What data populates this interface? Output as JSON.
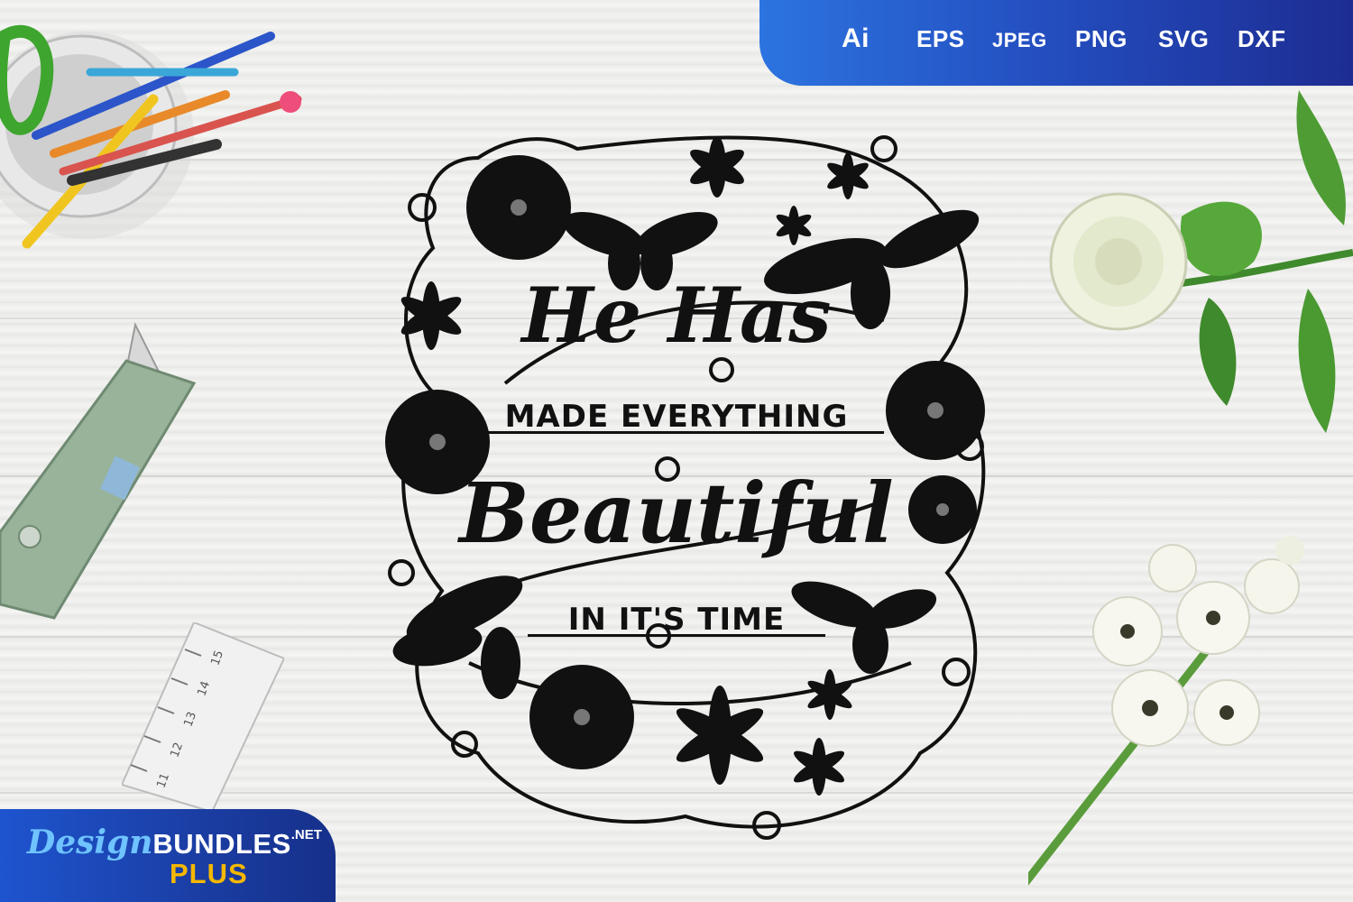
{
  "formats": {
    "items": [
      "Ai",
      "EPS",
      "JPEG",
      "PNG",
      "SVG",
      "DXF"
    ],
    "background_start": "#2c74e0",
    "background_end": "#1d2c92"
  },
  "quote": {
    "line1": "He Has",
    "line2": "MADE EVERYTHING",
    "line3": "Beautiful",
    "line4": "IN IT'S TIME",
    "color": "#111111"
  },
  "brand": {
    "script": "Design",
    "bold": "BUNDLES",
    "suffix": ".NET",
    "plus": "PLUS",
    "accent": "#f5b800"
  },
  "ruler": {
    "marks": [
      "11",
      "12",
      "13",
      "14",
      "15"
    ]
  },
  "decor": {
    "pencil_cup_icon": "pencil-cup-icon",
    "cutter_icon": "utility-knife-icon",
    "flower_icon": "white-rose-icon"
  }
}
